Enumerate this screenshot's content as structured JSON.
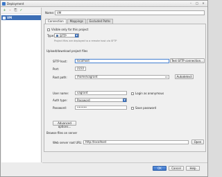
{
  "window": {
    "title": "Deployment"
  },
  "window_controls": {
    "minimize": "–",
    "maximize": "□",
    "close": "×"
  },
  "toolbar": {
    "add": "+",
    "remove": "–",
    "copy": "⎘",
    "check": "✓"
  },
  "servers": [
    {
      "label": "VM"
    }
  ],
  "name": {
    "label": "Name:",
    "value": "VM"
  },
  "tabs": [
    {
      "label": "Connection"
    },
    {
      "label": "Mappings"
    },
    {
      "label": "Excluded Paths"
    }
  ],
  "connection": {
    "visible_only_label": "Visible only for this project",
    "type_label": "Type:",
    "type_value": "SFTP",
    "type_hint": "Project files are deployed to a remote host via SFTP",
    "upload_section": "Upload/download project files",
    "sftp_host_label": "SFTP host:",
    "sftp_host_value": "localhost",
    "test_button": "Test SFTP connection...",
    "port_label": "Port:",
    "port_value": "2222",
    "root_path_label": "Root path:",
    "root_path_value": "/home/vagrant",
    "autodetect_button": "Autodetect",
    "user_name_label": "User name:",
    "user_name_value": "vagrant",
    "login_anon_label": "Login as anonymous",
    "auth_type_label": "Auth type:",
    "auth_type_value": "Password",
    "password_label": "Password:",
    "password_value": "••••••",
    "save_password_label": "Save password",
    "advanced_button": "Advanced options...",
    "browse_section": "Browse files on server",
    "web_root_label": "Web server root URL:",
    "web_root_value": "http://localhost",
    "open_button": "Open"
  },
  "footer": {
    "ok": "OK",
    "cancel": "Cancel",
    "help": "Help"
  }
}
